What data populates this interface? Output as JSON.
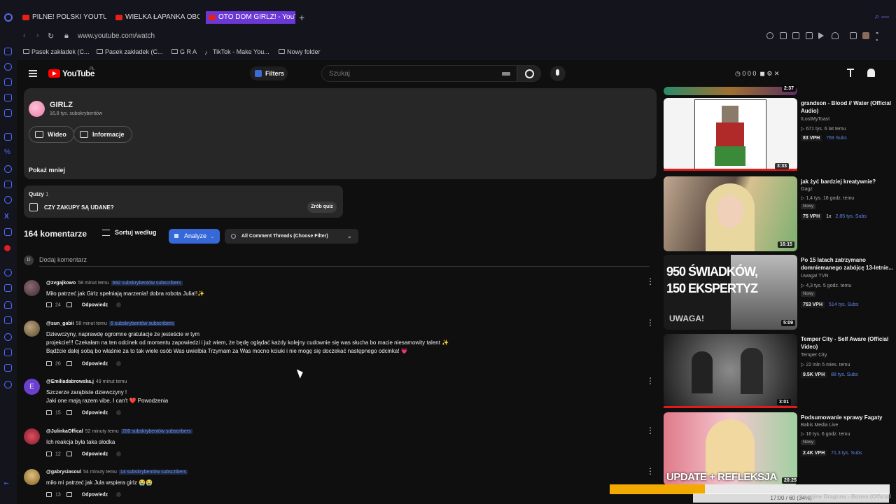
{
  "browser": {
    "tabs": [
      {
        "label": "PILNE! POLSKI YOUTUBER"
      },
      {
        "label": "WIELKA ŁAPANKA OBCOK"
      },
      {
        "label": "OTO DOM GIRLZ! - YouTub"
      }
    ],
    "url": "www.youtube.com/watch",
    "bookmarks": [
      "Pasek zakładek (C...",
      "Pasek zakładek (C...",
      "G R A",
      "TikTok - Make You...",
      "Nowy folder"
    ]
  },
  "yt_header": {
    "logo": "YouTube",
    "region": "PL",
    "filters_label": "Filters",
    "search_placeholder": "Szukaj",
    "stats": "0 0 0"
  },
  "channel": {
    "name": "GIRLZ",
    "subscribers": "16,8 tys. subskrybentów",
    "video_label": "Wideo",
    "info_label": "Informacje",
    "show_less": "Pokaż mniej"
  },
  "quiz": {
    "title": "Quizy",
    "count": "1",
    "question": "CZY ZAKUPY SĄ UDANE?",
    "take_label": "Zrób quiz"
  },
  "comments_header": {
    "count_label": "164 komentarze",
    "sort_label": "Sortuj według",
    "analyze_label": "Analyze",
    "threads_label": "All Comment Threads (Choose Filter)",
    "add_avatar": "D",
    "add_placeholder": "Dodaj komentarz"
  },
  "comments": [
    {
      "user": "@zvgajkowo",
      "time": "58 minut temu",
      "subs": "692 subskrybentów subscribers",
      "lines": [
        "Miło patrzeć jak Girlz spełniają marzenia! dobra robota Julia!!✨"
      ],
      "likes": "24",
      "reply": "Odpowiedz"
    },
    {
      "user": "@sun_gabii",
      "time": "58 minut temu",
      "subs": "6 subskrybentów subscribers",
      "lines": [
        "Dziewczyny, naprawdę ogromne gratulacje że jesteście w tym",
        "projekcie!!! Czekałam na ten odcinek od momentu zapowiedzi i już wiem, że będę oglądać każdy kolejny cudownie się was słucha bo macie niesamowity talent ✨",
        "Bądźcie dalej sobą bo właśnie za to tak wiele osób Was uwielbia Trzymam za Was mocno kciuki i nie mogę się doczekać następnego odcinka! 💗"
      ],
      "likes": "26",
      "reply": "Odpowiedz"
    },
    {
      "user": "@Emiliadabrowska.j",
      "time": "49 minut temu",
      "subs": "",
      "avatar_letter": "E",
      "lines": [
        "Szczerze zarąbiste dziewczyny !",
        "Jaki one mają razem vibe, I can't ❤️ Powodzenia"
      ],
      "likes": "15",
      "reply": "Odpowiedz"
    },
    {
      "user": "@JulinkaOffical",
      "time": "52 minuty temu",
      "subs": "200 subskrybentów subscribers",
      "lines": [
        "Ich reakcja była taka słodka"
      ],
      "likes": "12",
      "reply": "Odpowiedz"
    },
    {
      "user": "@gabrysiasoul",
      "time": "54 minuty temu",
      "subs": "14 subskrybentów subscribers",
      "lines": [
        "miło mi patrzeć jak Jula wspiera girlz 😭😭"
      ],
      "likes": "13",
      "reply": "Odpowiedz"
    }
  ],
  "related": [
    {
      "duration": "3:33",
      "title": "grandson - Blood // Water (Official Audio)",
      "channel": "ILostMyToast",
      "meta": "▷ 671 tys.  6 lat temu",
      "badge": "",
      "vph": "83 VPH",
      "mult": "",
      "subs": "769 Subs"
    },
    {
      "duration": "16:15",
      "title": "jak żyć bardziej kreatywnie?",
      "channel": "Gagz",
      "meta": "▷ 1,4 tys.  18 godz. temu",
      "badge": "Nowy",
      "vph": "75 VPH",
      "mult": "1x",
      "subs": "2,85 tys. Subs"
    },
    {
      "duration": "5:09",
      "title": "Po 15 latach zatrzymano domniemanego zabójcę 13-letnie...",
      "channel": "Uwaga! TVN",
      "meta": "▷ 4,3 tys.  5 godz. temu",
      "badge": "Nowy",
      "vph": "753 VPH",
      "mult": "",
      "subs": "514 tys. Subs",
      "thumb_text_1": "950 ŚWIADKÓW,",
      "thumb_text_2": "150 EKSPERTYZ",
      "thumb_text_3": "UWAGA!"
    },
    {
      "duration": "3:01",
      "title": "Temper City - Self Aware (Official Video)",
      "channel": "Temper City",
      "meta": "▷ 22 mln  5 mies. temu",
      "badge": "",
      "vph": "9.5K VPH",
      "mult": "",
      "subs": "88 tys. Subs"
    },
    {
      "duration": "20:25",
      "title": "Podsumowanie sprawy Fagaty",
      "channel": "Babis Media Live",
      "meta": "▷ 16 tys.  6 godz. temu",
      "badge": "Nowy",
      "vph": "2.4K VPH",
      "mult": "",
      "subs": "71,3 tys. Subs",
      "thumb_text_1": "UPDATE + REFLEKSJA"
    }
  ],
  "top_thumb_duration": "2:37",
  "next_title": "Imagine Dragons - Bones (Official",
  "progress": {
    "label": "17:00 / 60 (34%)",
    "fraction": 0.34
  }
}
